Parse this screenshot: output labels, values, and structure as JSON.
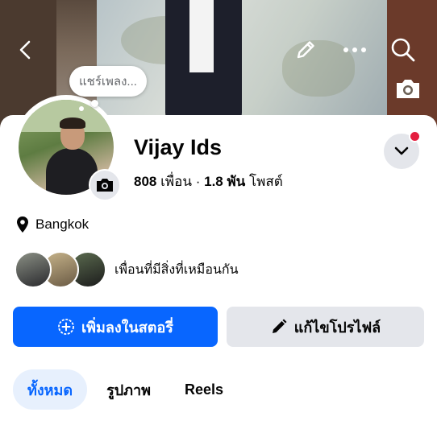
{
  "header": {
    "back_icon": "chevron-left-icon",
    "edit_icon": "pencil-icon",
    "more_icon": "more-dots-icon",
    "search_icon": "search-icon",
    "cover_camera_icon": "camera-icon"
  },
  "note": {
    "text": "แชร์เพลง..."
  },
  "profile": {
    "name": "Vijay Ids",
    "friends_count": "808",
    "friends_label": "เพื่อน",
    "separator": "·",
    "posts_count": "1.8 พัน",
    "posts_label": "โพสต์"
  },
  "location": {
    "text": "Bangkok"
  },
  "mutual": {
    "text": "เพื่อนที่มีสิ่งที่เหมือนกัน"
  },
  "actions": {
    "add_story_label": "เพิ่มลงในสตอรี่",
    "edit_profile_label": "แก้ไขโปรไฟล์"
  },
  "tabs": [
    {
      "label": "ทั้งหมด",
      "active": true
    },
    {
      "label": "รูปภาพ",
      "active": false
    },
    {
      "label": "Reels",
      "active": false
    }
  ],
  "colors": {
    "accent": "#0866ff",
    "secondary_button": "#e4e6eb",
    "active_tab_bg": "#e7f0fd",
    "notification_dot": "#e41e3f"
  }
}
